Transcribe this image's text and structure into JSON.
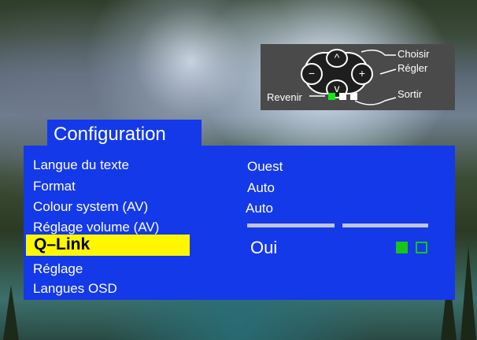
{
  "help": {
    "choisir": "Choisir",
    "regler": "Régler",
    "revenir": "Revenir",
    "sortir": "Sortir",
    "up_symbol": "^",
    "down_symbol": "v",
    "minus_symbol": "−",
    "plus_symbol": "+",
    "indicator_colors": [
      "#19e619",
      "#ffffff",
      "#ffffff"
    ]
  },
  "menu": {
    "title": "Configuration",
    "items": [
      {
        "label": "Langue du texte",
        "value": "Ouest"
      },
      {
        "label": "Format",
        "value": "Auto"
      },
      {
        "label": "Colour system (AV)",
        "value": "Auto"
      },
      {
        "label": "Réglage volume (AV)",
        "value": ""
      },
      {
        "label": "Q–Link",
        "value": "Oui",
        "selected": true
      },
      {
        "label": "Réglage",
        "value": ""
      },
      {
        "label": "Langues OSD",
        "value": ""
      }
    ],
    "status_squares": {
      "filled_color": "#19c419",
      "outline_color": "#19c419"
    }
  },
  "colors": {
    "menu_blue": "#1439e8",
    "highlight_yellow": "#fff700"
  }
}
